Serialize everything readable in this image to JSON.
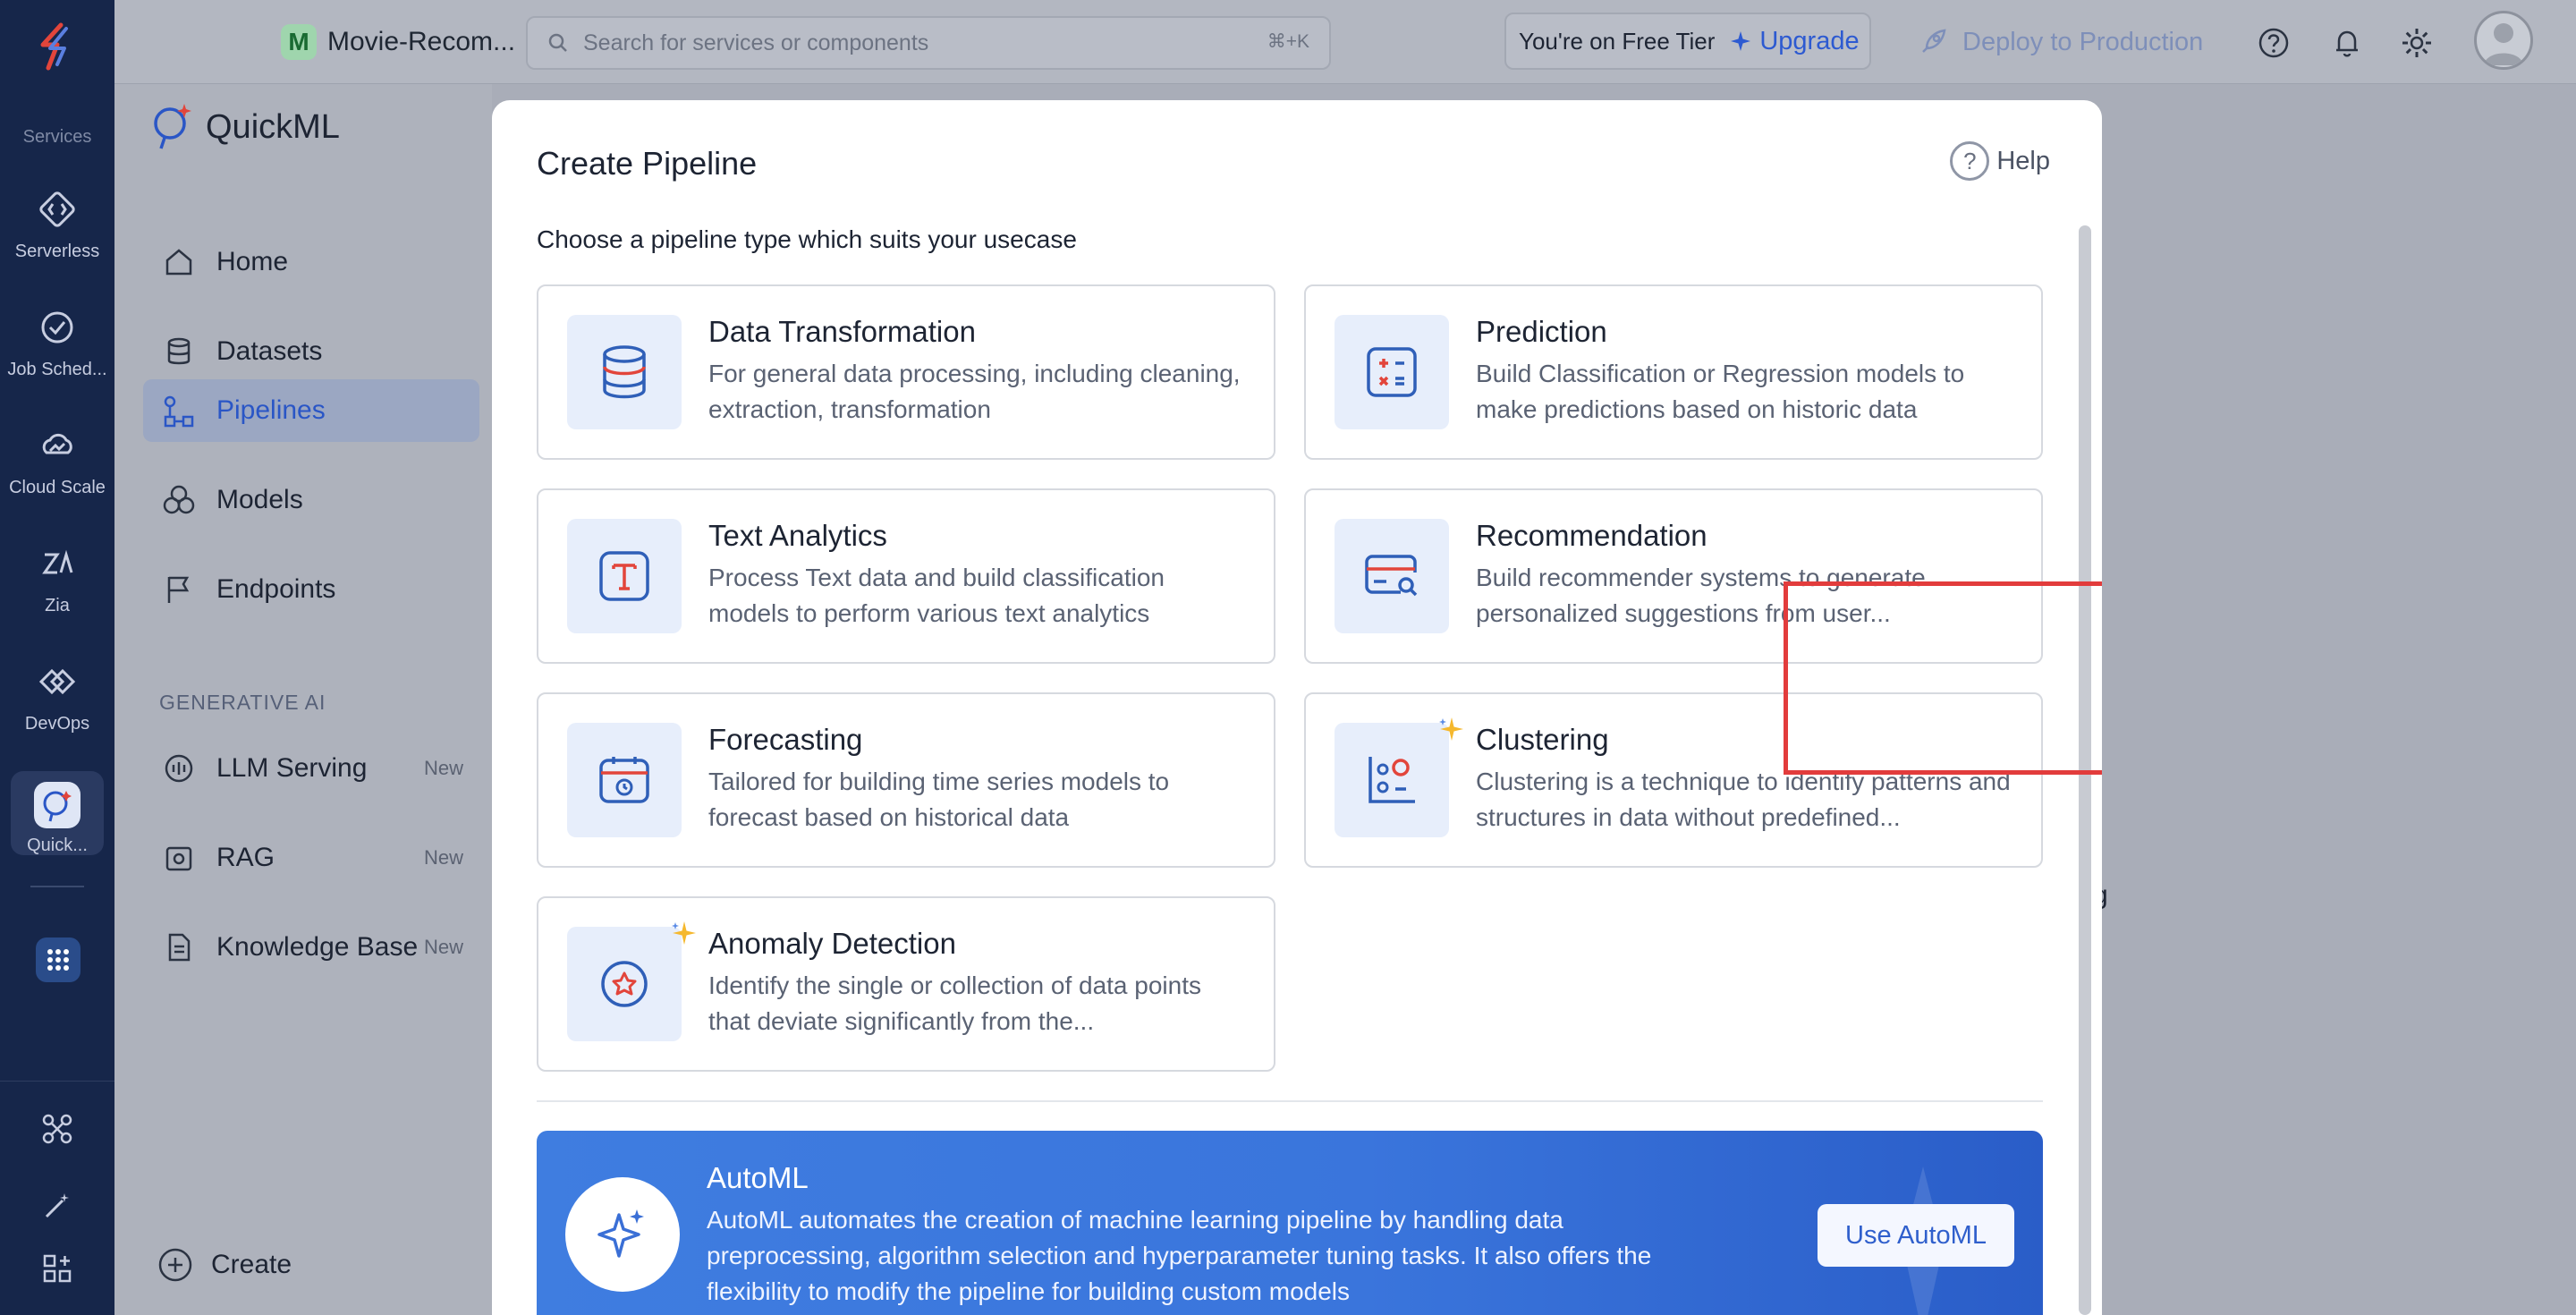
{
  "rail": {
    "section_label": "Services",
    "items": [
      {
        "label": "Serverless",
        "icon": "serverless-icon"
      },
      {
        "label": "Job Sched...",
        "icon": "job-scheduling-icon"
      },
      {
        "label": "Cloud Scale",
        "icon": "cloud-scale-icon"
      },
      {
        "label": "Zia",
        "icon": "zia-icon"
      },
      {
        "label": "DevOps",
        "icon": "devops-icon"
      },
      {
        "label": "Quick...",
        "icon": "quickml-icon",
        "active": true
      }
    ]
  },
  "topbar": {
    "project_initial": "M",
    "project_name": "Movie-Recom...",
    "search_placeholder": "Search for services or components",
    "search_shortcut": "⌘+K",
    "tier_text": "You're on Free Tier",
    "upgrade_label": "Upgrade",
    "deploy_label": "Deploy to Production"
  },
  "sidebar": {
    "brand": "QuickML",
    "items": [
      {
        "label": "Home"
      },
      {
        "label": "Datasets"
      },
      {
        "label": "Pipelines",
        "active": true
      },
      {
        "label": "Models"
      },
      {
        "label": "Endpoints"
      }
    ],
    "gen_ai_title": "GENERATIVE AI",
    "gen_items": [
      {
        "label": "LLM Serving",
        "badge": "New"
      },
      {
        "label": "RAG",
        "badge": "New"
      },
      {
        "label": "Knowledge Base",
        "badge": "New"
      }
    ],
    "create_label": "Create"
  },
  "background_fragment": "g",
  "modal": {
    "title": "Create Pipeline",
    "help_label": "Help",
    "subtitle": "Choose a pipeline type which suits your usecase",
    "cards": [
      {
        "title": "Data Transformation",
        "desc": "For general data processing, including cleaning, extraction, transformation",
        "icon": "database-icon"
      },
      {
        "title": "Prediction",
        "desc": "Build Classification or Regression models to make predictions based on historic data",
        "icon": "calculator-icon"
      },
      {
        "title": "Text Analytics",
        "desc": "Process Text data and build classification models to perform various text analytics",
        "icon": "text-icon"
      },
      {
        "title": "Recommendation",
        "desc": "Build recommender systems to generate personalized suggestions from user...",
        "icon": "card-search-icon",
        "highlighted": true
      },
      {
        "title": "Forecasting",
        "desc": "Tailored for building time series models to forecast based on historical data",
        "icon": "calendar-clock-icon"
      },
      {
        "title": "Clustering",
        "desc": "Clustering is a technique to identify patterns and structures in data without predefined...",
        "icon": "scatter-icon",
        "sparkle": true
      },
      {
        "title": "Anomaly Detection",
        "desc": "Identify the single or collection of data points that deviate significantly from the...",
        "icon": "anomaly-icon",
        "sparkle": true
      }
    ],
    "automl": {
      "title": "AutoML",
      "desc": "AutoML automates the creation of machine learning pipeline by handling data preprocessing, algorithm selection and hyperparameter tuning tasks. It also offers the flexibility to modify the pipeline for building custom models",
      "button": "Use AutoML"
    }
  },
  "colors": {
    "accent": "#2d5ad1",
    "highlight_border": "#e23c3c",
    "rail_bg": "#16264a"
  }
}
